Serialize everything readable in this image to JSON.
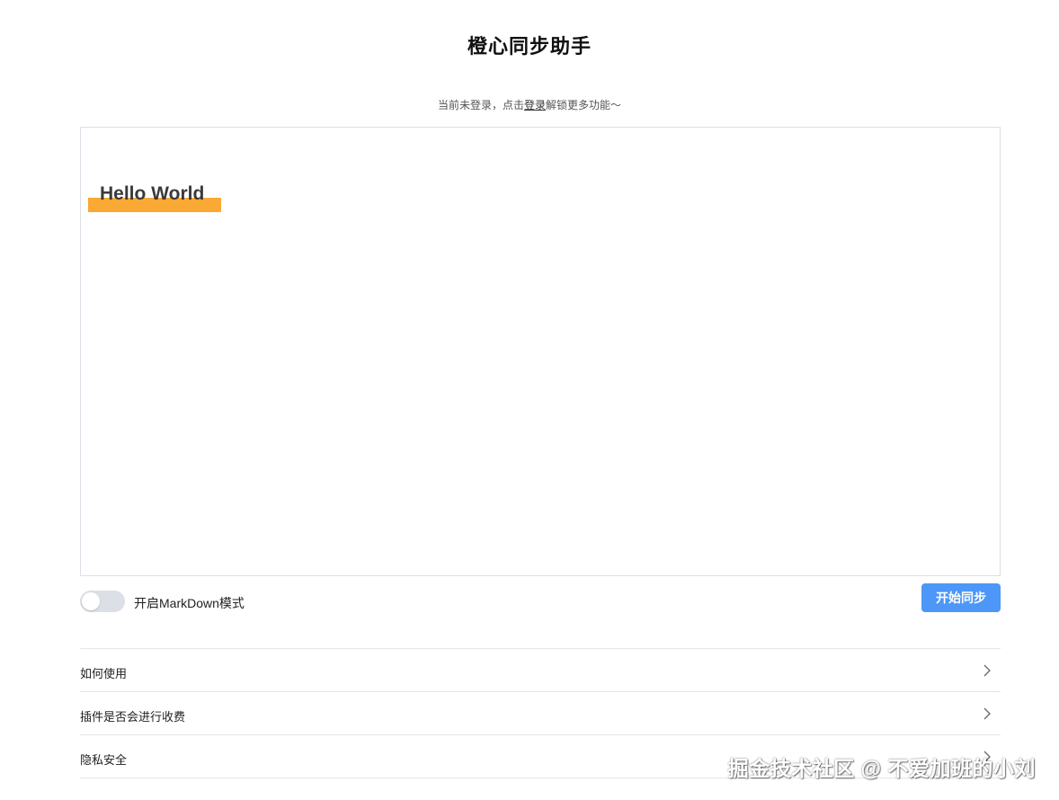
{
  "header": {
    "title": "橙心同步助手"
  },
  "login_tip": {
    "prefix": "当前未登录，点击",
    "link": "登录",
    "suffix": "解锁更多功能～"
  },
  "editor": {
    "heading_text": "Hello World",
    "highlight_color": "#f9a934"
  },
  "controls": {
    "markdown_toggle_label": "开启MarkDown模式",
    "markdown_enabled": false,
    "sync_button_label": "开始同步",
    "accent_color": "#4c97f7"
  },
  "faq": {
    "items": [
      {
        "label": "如何使用",
        "icon": "chevron-right-icon"
      },
      {
        "label": "插件是否会进行收费",
        "icon": "chevron-right-icon"
      },
      {
        "label": "隐私安全",
        "icon": "chevron-right-icon"
      }
    ]
  },
  "watermark": {
    "text": "掘金技术社区 @ 不爱加班的小刘"
  }
}
